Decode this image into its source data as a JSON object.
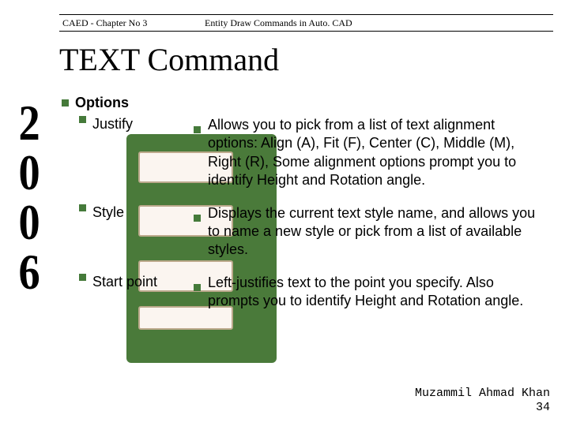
{
  "header": {
    "left": "CAED - Chapter No 3",
    "right": "Entity Draw Commands in Auto. CAD"
  },
  "title": "TEXT Command",
  "side_year": "2006",
  "options_label": "Options",
  "options": [
    {
      "name": "Justify",
      "desc": "Allows you to pick from a list of text alignment options: Align (A), Fit (F), Center (C), Middle (M), Right (R), Some alignment options prompt you to identify Height and Rotation angle."
    },
    {
      "name": "Style",
      "desc": "Displays the current text style name, and allows you to name a new style or pick from a list of available styles."
    },
    {
      "name": "Start point",
      "desc": "Left-justifies text to the point you specify. Also prompts you to identify Height and Rotation angle."
    }
  ],
  "footer": {
    "author": "Muzammil Ahmad Khan",
    "page": "34"
  }
}
